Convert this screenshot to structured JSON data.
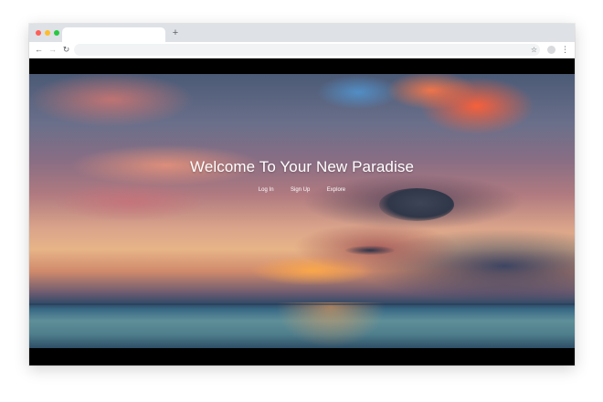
{
  "browser": {
    "new_tab_symbol": "+",
    "back_symbol": "←",
    "forward_symbol": "→",
    "reload_symbol": "↻",
    "bookmark_symbol": "☆",
    "menu_symbol": "⋮",
    "icons": [
      "back-arrow-icon",
      "forward-arrow-icon",
      "reload-icon",
      "star-icon",
      "profile-icon",
      "kebab-menu-icon"
    ]
  },
  "hero": {
    "title": "Welcome To Your New Paradise",
    "nav": [
      {
        "label": "Log In"
      },
      {
        "label": "Sign Up"
      },
      {
        "label": "Explore"
      }
    ]
  },
  "colors": {
    "window_chrome": "#dee1e6",
    "letterbox": "#000000",
    "text": "#ffffff"
  }
}
